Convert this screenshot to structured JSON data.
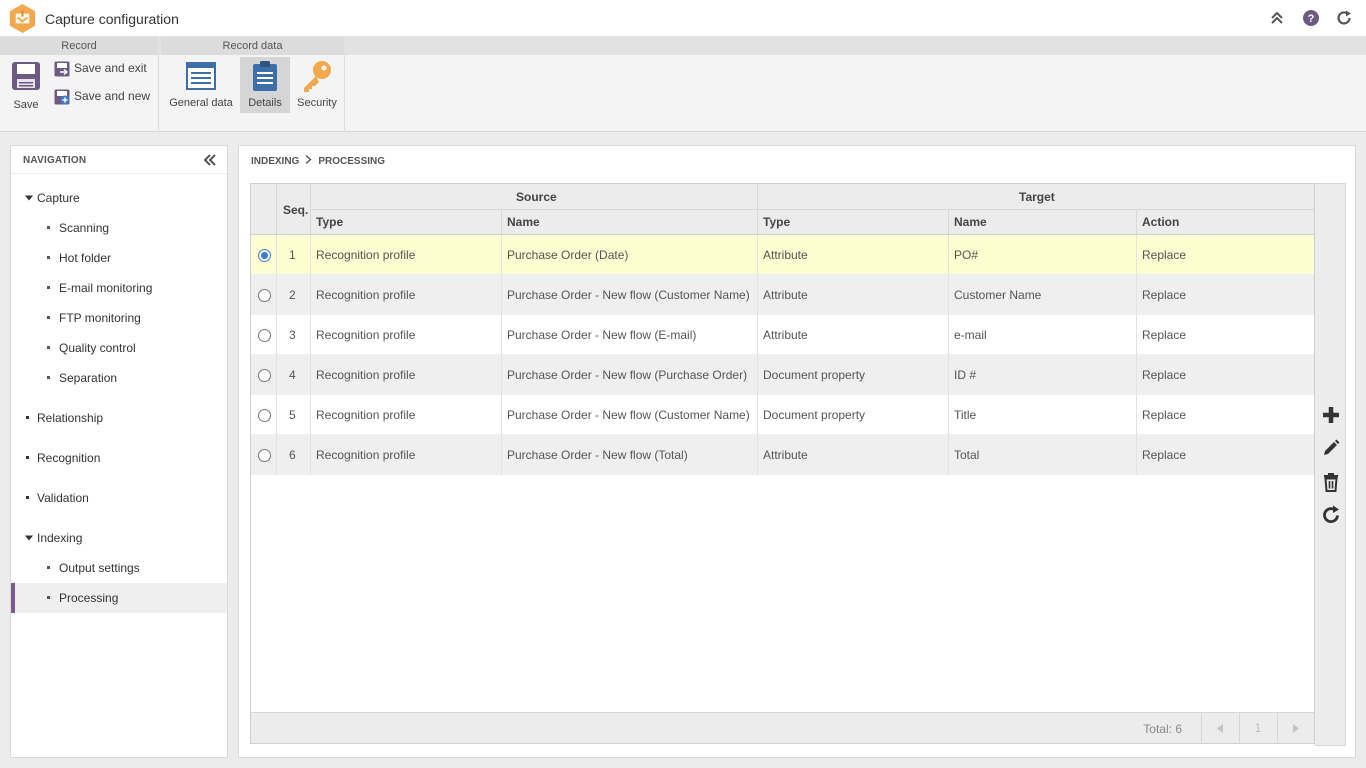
{
  "app": {
    "title": "Capture configuration",
    "brand_color": "#f2a94e",
    "accent_color": "#7d5a8c"
  },
  "header_icons": [
    "collapse-up-icon",
    "help-icon",
    "refresh-icon"
  ],
  "ribbon": {
    "groups": [
      {
        "title": "Record"
      },
      {
        "title": "Record data"
      }
    ],
    "buttons": {
      "save": "Save",
      "save_exit": "Save and exit",
      "save_new": "Save and new",
      "general_data": "General data",
      "details": "Details",
      "security": "Security"
    }
  },
  "nav": {
    "title": "NAVIGATION",
    "items": [
      {
        "label": "Capture",
        "level": 0,
        "expanded": true
      },
      {
        "label": "Scanning",
        "level": 1
      },
      {
        "label": "Hot folder",
        "level": 1
      },
      {
        "label": "E-mail monitoring",
        "level": 1
      },
      {
        "label": "FTP monitoring",
        "level": 1
      },
      {
        "label": "Quality control",
        "level": 1
      },
      {
        "label": "Separation",
        "level": 1
      },
      {
        "label": "Relationship",
        "level": 0
      },
      {
        "label": "Recognition",
        "level": 0
      },
      {
        "label": "Validation",
        "level": 0
      },
      {
        "label": "Indexing",
        "level": 0,
        "expanded": true
      },
      {
        "label": "Output settings",
        "level": 1
      },
      {
        "label": "Processing",
        "level": 1,
        "selected": true
      }
    ]
  },
  "breadcrumb": {
    "parent": "INDEXING",
    "current": "PROCESSING"
  },
  "grid": {
    "headers": {
      "seq": "Seq.",
      "source": "Source",
      "target": "Target",
      "source_type": "Type",
      "source_name": "Name",
      "target_type": "Type",
      "target_name": "Name",
      "action": "Action"
    },
    "rows": [
      {
        "seq": "1",
        "source_type": "Recognition profile",
        "source_name": "Purchase Order (Date)",
        "target_type": "Attribute",
        "target_name": "PO#",
        "action": "Replace",
        "selected": true
      },
      {
        "seq": "2",
        "source_type": "Recognition profile",
        "source_name": "Purchase Order - New flow (Customer Name)",
        "target_type": "Attribute",
        "target_name": "Customer Name",
        "action": "Replace"
      },
      {
        "seq": "3",
        "source_type": "Recognition profile",
        "source_name": "Purchase Order - New flow (E-mail)",
        "target_type": "Attribute",
        "target_name": "e-mail",
        "action": "Replace"
      },
      {
        "seq": "4",
        "source_type": "Recognition profile",
        "source_name": "Purchase Order - New flow (Purchase Order)",
        "target_type": "Document property",
        "target_name": "ID #",
        "action": "Replace"
      },
      {
        "seq": "5",
        "source_type": "Recognition profile",
        "source_name": "Purchase Order - New flow (Customer Name)",
        "target_type": "Document property",
        "target_name": "Title",
        "action": "Replace"
      },
      {
        "seq": "6",
        "source_type": "Recognition profile",
        "source_name": "Purchase Order - New flow (Total)",
        "target_type": "Attribute",
        "target_name": "Total",
        "action": "Replace"
      }
    ],
    "footer": {
      "total": "Total: 6",
      "page": "1"
    }
  },
  "side_toolbar": [
    "add-icon",
    "edit-icon",
    "delete-icon",
    "refresh-icon"
  ]
}
